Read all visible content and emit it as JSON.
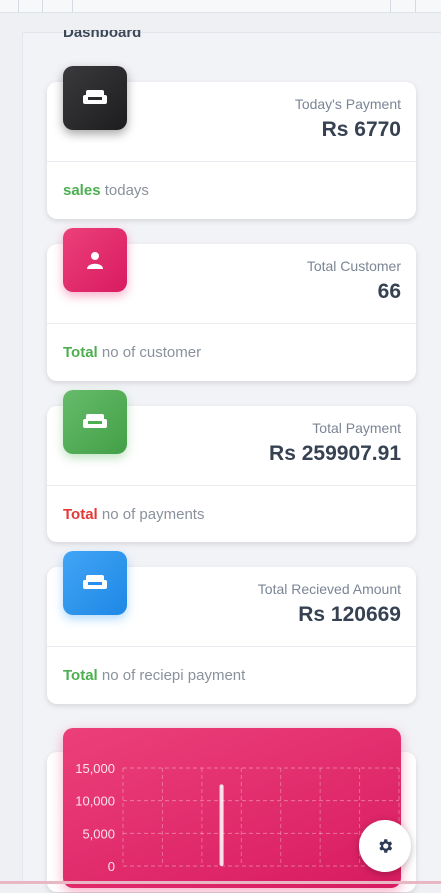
{
  "header": {
    "title": "Dashboard"
  },
  "cards": [
    {
      "label": "Today's Payment",
      "value": "Rs 6770",
      "footer_highlight": "sales",
      "footer_text": " todays",
      "highlight_color": "#4caf50",
      "icon": "couch-icon"
    },
    {
      "label": "Total Customer",
      "value": "66",
      "footer_highlight": "Total",
      "footer_text": " no of customer",
      "highlight_color": "#4caf50",
      "icon": "person-icon"
    },
    {
      "label": "Total Payment",
      "value": "Rs 259907.91",
      "footer_highlight": "Total",
      "footer_text": " no of payments",
      "highlight_color": "#e53935",
      "icon": "couch-icon"
    },
    {
      "label": "Total Recieved Amount",
      "value": "Rs 120669",
      "footer_highlight": "Total",
      "footer_text": " no of reciepi payment",
      "highlight_color": "#4caf50",
      "icon": "couch-icon"
    }
  ],
  "chart_data": {
    "type": "bar",
    "yticks": [
      "15,000",
      "10,000",
      "5,000",
      "0"
    ],
    "ylim": [
      0,
      15000
    ],
    "values": [
      0,
      0,
      12500,
      0,
      0,
      0,
      300
    ],
    "grid": true
  },
  "settings": {
    "icon": "gear-icon"
  },
  "colors": {
    "accent_pink": "#e91e63",
    "accent_green": "#4caf50",
    "accent_blue": "#2196f3",
    "text_dark": "#364152"
  }
}
